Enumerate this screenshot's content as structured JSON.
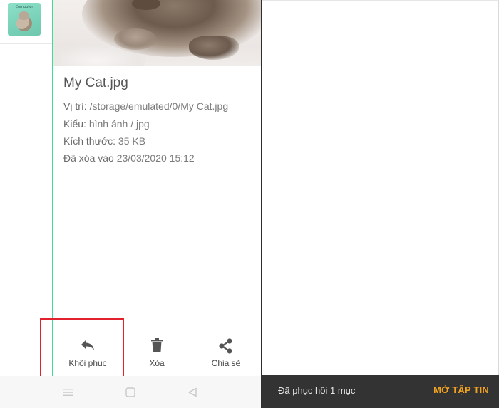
{
  "left_screen": {
    "thumbnail": {
      "caption": "Computer"
    },
    "file": {
      "name": "My Cat.jpg",
      "location_label": "Vị trí:",
      "location_value": "/storage/emulated/0/My Cat.jpg",
      "type_label": "Kiểu:",
      "type_value": "hình ảnh / jpg",
      "size_label": "Kích thước:",
      "size_value": "35 KB",
      "deleted_label": "Đã xóa vào",
      "deleted_value": "23/03/2020 15:12"
    },
    "actions": {
      "restore_label": "Khôi phục",
      "delete_label": "Xóa",
      "share_label": "Chia sẻ"
    }
  },
  "right_screen": {
    "snackbar": {
      "message": "Đã phục hồi 1 mục",
      "action_label": "MỞ TẬP TIN"
    }
  },
  "colors": {
    "highlight_box": "#e2212e",
    "accent_line": "#3ddc97",
    "snackbar_bg": "#333333",
    "snackbar_action": "#f3a321"
  },
  "icons": {
    "restore": "reply-arrow-icon",
    "delete": "trash-icon",
    "share": "share-icon",
    "nav_menu": "menu-icon",
    "nav_home": "home-square-icon",
    "nav_back": "back-triangle-icon"
  }
}
